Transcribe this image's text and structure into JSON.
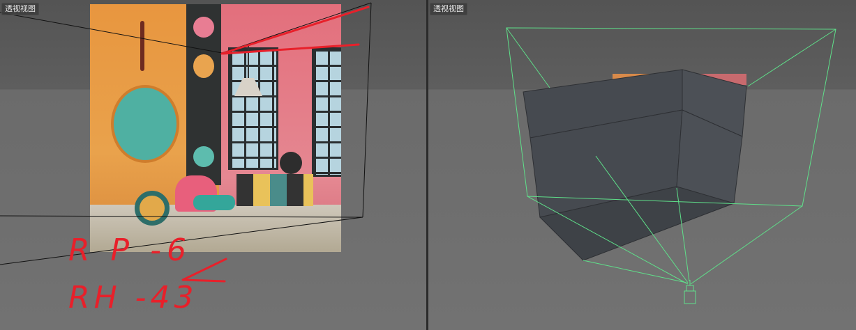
{
  "viewports": {
    "left": {
      "label": "透视视图"
    },
    "right": {
      "label": "透视视图"
    }
  },
  "annotations": {
    "line1": "R P -6",
    "line2": "RH -43"
  },
  "colors": {
    "annotation_red": "#e8202a",
    "camera_wire_green": "#5fe08a",
    "mesh_gray": "#474b51",
    "viewport_bg": "#6b6b6b"
  }
}
